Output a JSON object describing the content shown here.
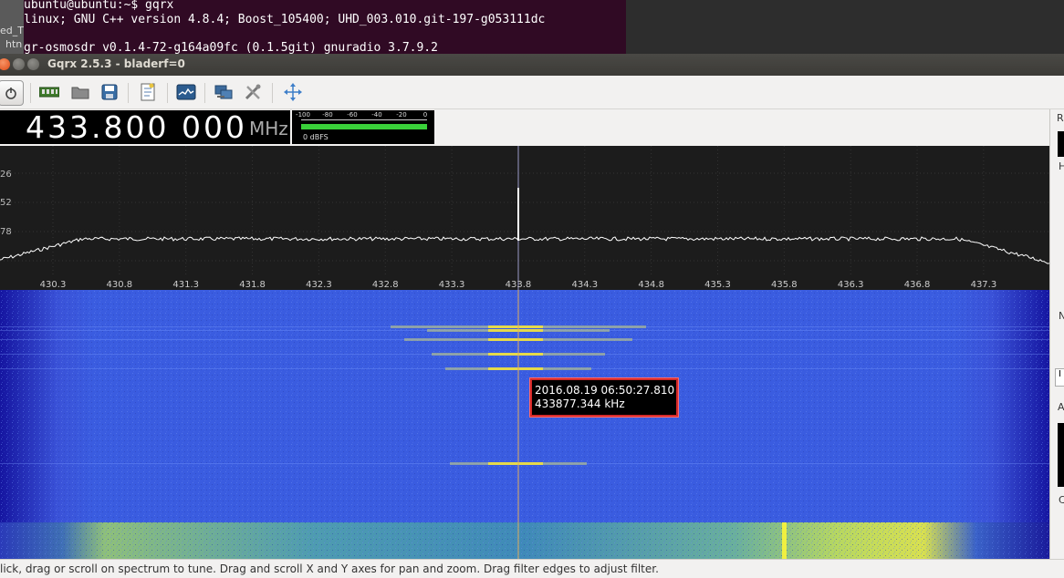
{
  "terminal": {
    "lines": [
      "ubuntu@ubuntu:~$ gqrx",
      "linux; GNU C++ version 4.8.4; Boost_105400; UHD_003.010.git-197-g053111dc",
      "gr-osmosdr v0.1.4-72-g164a09fc (0.1.5git) gnuradio 3.7.9.2"
    ],
    "side_labels": [
      "ed_T",
      "htn"
    ]
  },
  "window": {
    "title": "Gqrx 2.5.3 - bladerf=0"
  },
  "toolbar": {
    "icons": [
      "power-icon",
      "hardware-board-icon",
      "folder-open-icon",
      "save-icon",
      "notes-icon",
      "fft-settings-icon",
      "network-icon",
      "tools-icon",
      "center-arrows-icon"
    ]
  },
  "frequency": {
    "value": "433.800 000",
    "unit": "MHz"
  },
  "meter": {
    "ticks": [
      "-100",
      "-80",
      "-60",
      "-40",
      "-20",
      "0"
    ],
    "label": "0 dBFS",
    "level_fraction": 1.0
  },
  "spectrum": {
    "y_ticks": [
      "26",
      "52",
      "78"
    ],
    "x_ticks": [
      "430.3",
      "430.8",
      "431.3",
      "431.8",
      "432.3",
      "432.8",
      "433.3",
      "433.8",
      "434.3",
      "434.8",
      "435.3",
      "435.8",
      "436.3",
      "436.8",
      "437.3"
    ],
    "center_marker_frequency": "433.8"
  },
  "tooltip": {
    "timestamp": "2016.08.19 06:50:27.810",
    "frequency": "433877.344 kHz"
  },
  "side_panel": {
    "letters": [
      "R",
      "H",
      "N",
      "A",
      "C"
    ],
    "box_label": "I"
  },
  "status": {
    "text": "lick, drag or scroll on spectrum to tune. Drag and scroll X and Y axes for pan and zoom. Drag filter edges to adjust filter."
  },
  "colors": {
    "waterfall_base": "#3a5ce0",
    "waterfall_edge": "#1a1a9a",
    "signal_yellow": "#e8e040",
    "tooltip_border": "#d42a2a",
    "meter_green": "#3ad13a"
  }
}
